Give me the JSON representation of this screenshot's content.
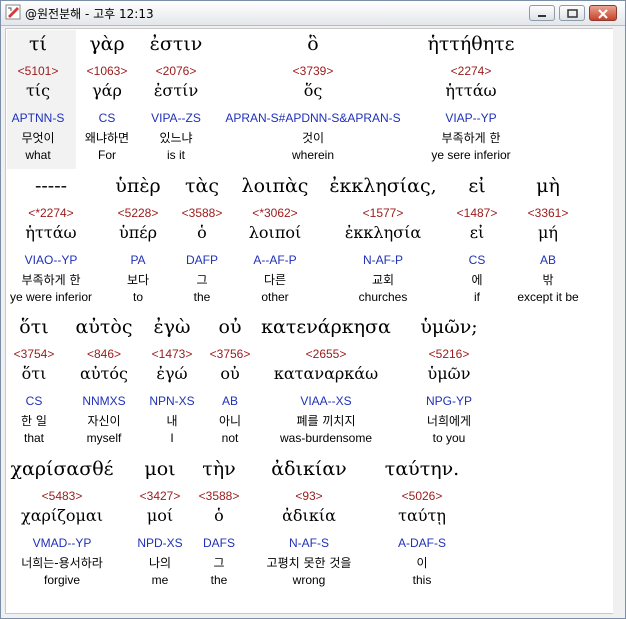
{
  "window": {
    "title": "@원전분해 - 고후 12:13"
  },
  "blocks": [
    {
      "words": [
        {
          "greek": "τί",
          "strong": "<5101>",
          "lemma": "τίς",
          "parse": "APTNN-S",
          "korean": "무엇이",
          "english": "what"
        },
        {
          "greek": "γὰρ",
          "strong": "<1063>",
          "lemma": "γάρ",
          "parse": "CS",
          "korean": "왜냐하면",
          "english": "For"
        },
        {
          "greek": "ἐστιν",
          "strong": "<2076>",
          "lemma": "ἐστίν",
          "parse": "VIPA--ZS",
          "korean": "있느냐",
          "english": "is it"
        },
        {
          "greek": "ὃ",
          "strong": "<3739>",
          "lemma": "ὅς",
          "parse": "APRAN-S#APDNN-S&APRAN-S",
          "korean": "것이",
          "english": "wherein"
        },
        {
          "greek": "ἡττήθητε",
          "strong": "<2274>",
          "lemma": "ἡττάω",
          "parse": "VIAP--YP",
          "korean": "부족하게 한",
          "english": "ye sere inferior"
        }
      ]
    },
    {
      "words": [
        {
          "greek": "-----",
          "strong": "<*2274>",
          "lemma": "ἡττάω",
          "parse": "VIAO--YP",
          "korean": "부족하게 한",
          "english": "ye were inferior"
        },
        {
          "greek": "ὑπὲρ",
          "strong": "<5228>",
          "lemma": "ὑπέρ",
          "parse": "PA",
          "korean": "보다",
          "english": "to"
        },
        {
          "greek": "τὰς",
          "strong": "<3588>",
          "lemma": "ὁ",
          "parse": "DAFP",
          "korean": "그",
          "english": "the"
        },
        {
          "greek": "λοιπὰς",
          "strong": "<*3062>",
          "lemma": "λοιποί",
          "parse": "A--AF-P",
          "korean": "다른",
          "english": "other"
        },
        {
          "greek": "ἐκκλησίας,",
          "strong": "<1577>",
          "lemma": "ἐκκλησία",
          "parse": "N-AF-P",
          "korean": "교회",
          "english": "churches"
        },
        {
          "greek": "εἰ",
          "strong": "<1487>",
          "lemma": "εἰ",
          "parse": "CS",
          "korean": "에",
          "english": "if"
        },
        {
          "greek": "μὴ",
          "strong": "<3361>",
          "lemma": "μή",
          "parse": "AB",
          "korean": "밖",
          "english": "except it be"
        }
      ]
    },
    {
      "words": [
        {
          "greek": "ὅτι",
          "strong": "<3754>",
          "lemma": "ὅτι",
          "parse": "CS",
          "korean": "한 일",
          "english": "that"
        },
        {
          "greek": "αὐτὸς",
          "strong": "<846>",
          "lemma": "αὐτός",
          "parse": "NNMXS",
          "korean": "자신이",
          "english": "myself"
        },
        {
          "greek": "ἐγὼ",
          "strong": "<1473>",
          "lemma": "ἐγώ",
          "parse": "NPN-XS",
          "korean": "내",
          "english": "I"
        },
        {
          "greek": "οὐ",
          "strong": "<3756>",
          "lemma": "οὐ",
          "parse": "AB",
          "korean": "아니",
          "english": "not"
        },
        {
          "greek": "κατενάρκησα",
          "strong": "<2655>",
          "lemma": "καταναρκάω",
          "parse": "VIAA--XS",
          "korean": "폐를 끼치지",
          "english": "was-burdensome"
        },
        {
          "greek": "ὑμῶν;",
          "strong": "<5216>",
          "lemma": "ὑμῶν",
          "parse": "NPG-YP",
          "korean": "너희에게",
          "english": "to you"
        }
      ]
    },
    {
      "words": [
        {
          "greek": "χαρίσασθέ",
          "strong": "<5483>",
          "lemma": "χαρίζομαι",
          "parse": "VMAD--YP",
          "korean": "너희는-용서하라",
          "english": "forgive"
        },
        {
          "greek": "μοι",
          "strong": "<3427>",
          "lemma": "μοί",
          "parse": "NPD-XS",
          "korean": "나의",
          "english": "me"
        },
        {
          "greek": "τὴν",
          "strong": "<3588>",
          "lemma": "ὁ",
          "parse": "DAFS",
          "korean": "그",
          "english": "the"
        },
        {
          "greek": "ἀδικίαν",
          "strong": "<93>",
          "lemma": "ἀδικία",
          "parse": "N-AF-S",
          "korean": "고평치 못한 것을",
          "english": "wrong"
        },
        {
          "greek": "ταύτην.",
          "strong": "<5026>",
          "lemma": "ταύτῃ",
          "parse": "A-DAF-S",
          "korean": "이",
          "english": "this"
        }
      ]
    }
  ]
}
